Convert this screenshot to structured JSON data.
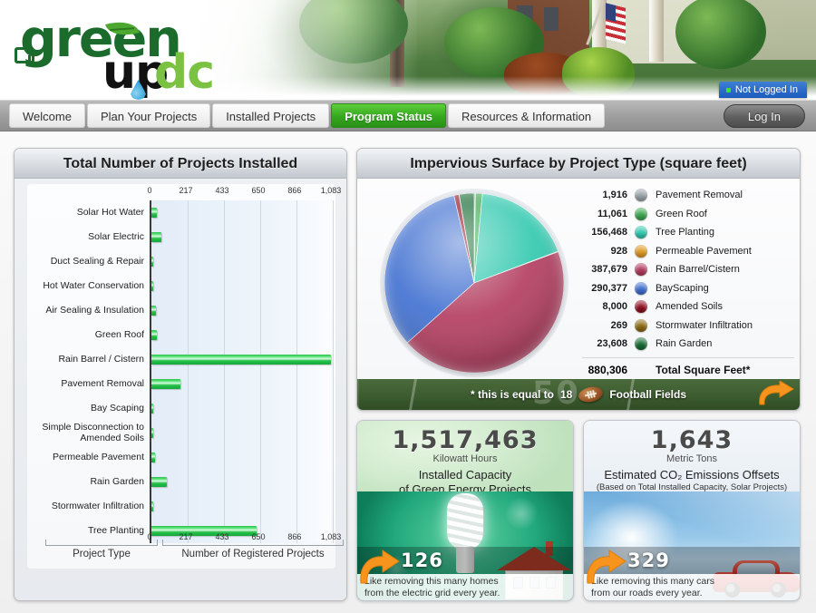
{
  "site": {
    "logo_green": "green",
    "logo_up": "up",
    "logo_dc": "dc",
    "login_status": "Not Logged In",
    "login_button": "Log In"
  },
  "nav": {
    "tabs": [
      {
        "label": "Welcome",
        "active": false
      },
      {
        "label": "Plan Your Projects",
        "active": false
      },
      {
        "label": "Installed Projects",
        "active": false
      },
      {
        "label": "Program Status",
        "active": true
      },
      {
        "label": "Resources & Information",
        "active": false
      }
    ]
  },
  "bars_panel": {
    "title": "Total Number of Projects Installed",
    "x_caption": "Number of Registered Projects",
    "y_caption": "Project Type"
  },
  "pie_panel": {
    "title": "Impervious Surface by Project Type (square feet)",
    "total_value": "880,306",
    "total_label": "Total Square Feet*",
    "footnote_prefix": "* this is equal to",
    "footnote_number": "18",
    "footnote_suffix": "Football Fields"
  },
  "energy_panel": {
    "value": "1,517,463",
    "unit": "Kilowatt Hours",
    "desc_line1": "Installed Capacity",
    "desc_line2": "of Green Energy Projects",
    "count": "126",
    "foot_line1": "Like removing this many homes",
    "foot_line2": "from the electric grid every year."
  },
  "co2_panel": {
    "value": "1,643",
    "unit": "Metric Tons",
    "desc_line1": "Estimated CO₂ Emissions Offsets",
    "desc_line2": "(Based on Total Installed Capacity, Solar Projects)",
    "count": "329",
    "foot_line1": "Like removing this many cars",
    "foot_line2": "from our roads every year."
  },
  "chart_data": [
    {
      "type": "bar",
      "title": "Total Number of Projects Installed",
      "xlabel": "Number of Registered Projects",
      "ylabel": "Project Type",
      "orientation": "horizontal",
      "xlim": [
        0,
        1083
      ],
      "ticks": [
        0,
        217,
        433,
        650,
        866,
        1083
      ],
      "tick_labels": [
        "0",
        "217",
        "433",
        "650",
        "866",
        "1,083"
      ],
      "grid": true,
      "categories": [
        "Solar Hot Water",
        "Solar Electric",
        "Duct Sealing & Repair",
        "Hot Water Conservation",
        "Air Sealing & Insulation",
        "Green Roof",
        "Rain Barrel / Cistern",
        "Pavement Removal",
        "Bay Scaping",
        "Simple Disconnection to Amended Soils",
        "Permeable Pavement",
        "Rain Garden",
        "Stormwater Infiltration",
        "Tree Planting"
      ],
      "values": [
        30,
        58,
        5,
        6,
        26,
        30,
        1083,
        172,
        9,
        6,
        22,
        90,
        5,
        630
      ]
    },
    {
      "type": "pie",
      "title": "Impervious Surface by Project Type (square feet)",
      "unit": "square feet",
      "total": 880306,
      "legend_position": "right",
      "labels": [
        "Pavement Removal",
        "Green Roof",
        "Tree Planting",
        "Permeable Pavement",
        "Rain Barrel/Cistern",
        "BayScaping",
        "Amended Soils",
        "Stormwater Infiltration",
        "Rain Garden"
      ],
      "values": [
        1916,
        11061,
        156468,
        928,
        387679,
        290377,
        8000,
        269,
        23608
      ],
      "value_labels": [
        "1,916",
        "11,061",
        "156,468",
        "928",
        "387,679",
        "290,377",
        "8,000",
        "269",
        "23,608"
      ],
      "colors": [
        "#9aa3ab",
        "#3aa84f",
        "#2fc8ae",
        "#e09a20",
        "#b23a5e",
        "#3f6fd0",
        "#8e1020",
        "#8a6a10",
        "#156b33"
      ]
    }
  ]
}
